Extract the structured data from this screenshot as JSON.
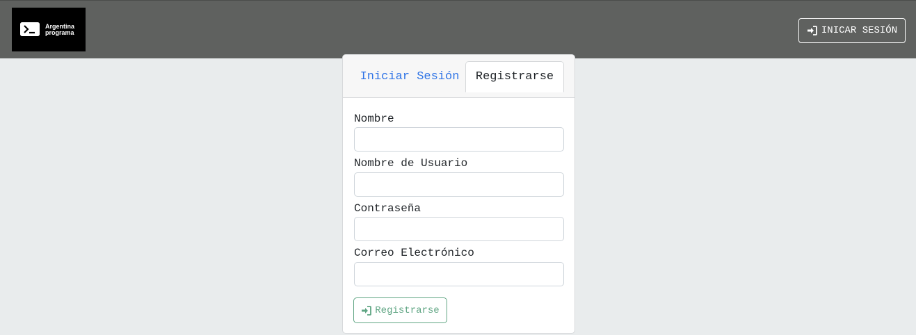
{
  "header": {
    "logo_line1": "Argentina",
    "logo_line2": "programa",
    "login_button_label": "INICAR SESIÓN",
    "background_color": "#5f615f"
  },
  "tabs": {
    "login_label": "Iniciar Sesión",
    "register_label": "Registrarse",
    "active": "Registrarse"
  },
  "form": {
    "fields": [
      {
        "label": "Nombre",
        "value": "",
        "placeholder": ""
      },
      {
        "label": "Nombre de Usuario",
        "value": "",
        "placeholder": ""
      },
      {
        "label": "Contraseña",
        "value": "",
        "placeholder": ""
      },
      {
        "label": "Correo Electrónico",
        "value": "",
        "placeholder": ""
      }
    ],
    "submit_label": "Registrarse",
    "submit_color": "#5fa583"
  },
  "icons": {
    "logo": "terminal-prompt-icon",
    "login": "sign-in-icon",
    "submit": "sign-in-icon"
  }
}
